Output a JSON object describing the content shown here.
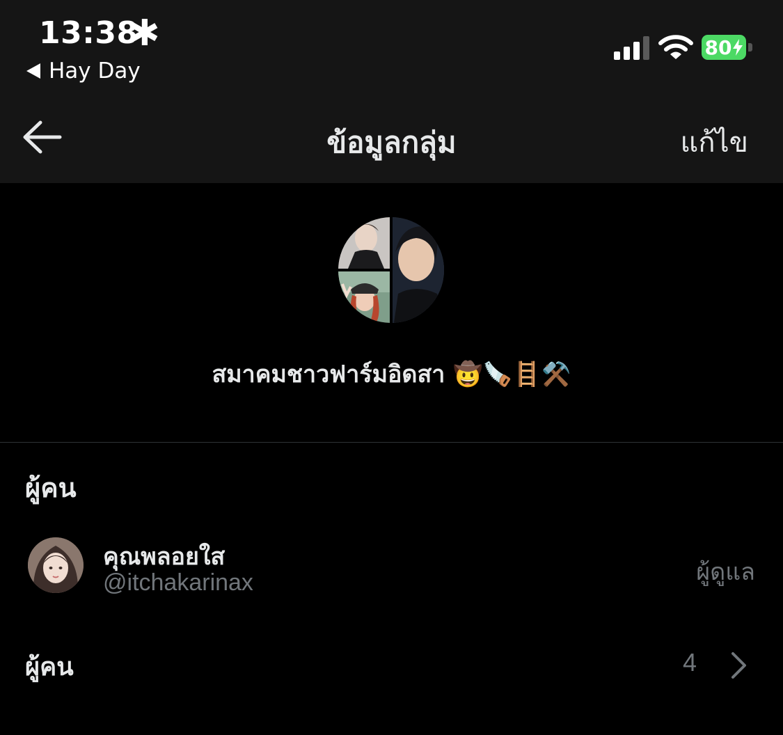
{
  "status_bar": {
    "time": "13:38",
    "back_app_label": "Hay Day",
    "battery_percent": "80",
    "battery_color": "#4cd964"
  },
  "nav": {
    "title": "ข้อมูลกลุ่ม",
    "edit_label": "แก้ไข",
    "back_icon": "arrow-left-icon"
  },
  "group": {
    "name": "สมาคมชาวฟาร์มอิดสา 🤠🪚🪜⚒️"
  },
  "people_section": {
    "title": "ผู้คน",
    "members": [
      {
        "display_name": "คุณพลอยใส",
        "handle": "@itchakarinax",
        "role": "ผู้ดูแล"
      }
    ],
    "people_row_label": "ผู้คน",
    "people_count": "4"
  },
  "theme": {
    "background": "#000000",
    "bar_background": "#151515",
    "primary_text": "#e7e9ea",
    "secondary_text": "#71767b",
    "accent": "#1d9bf0"
  }
}
